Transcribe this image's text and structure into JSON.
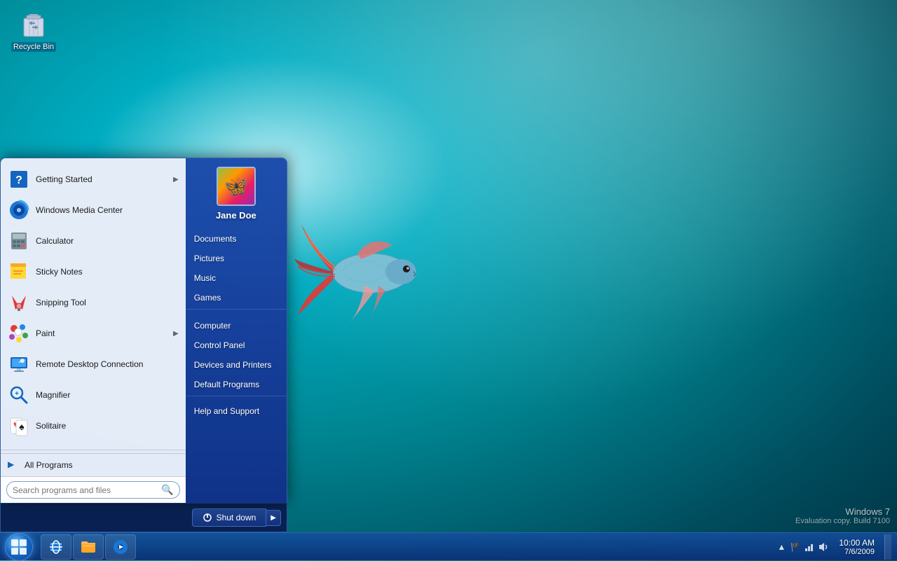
{
  "desktop": {
    "background": "underwater teal",
    "icons": [
      {
        "id": "recycle-bin",
        "label": "Recycle Bin"
      }
    ]
  },
  "taskbar": {
    "apps": [
      {
        "id": "start",
        "label": "Start"
      },
      {
        "id": "ie",
        "label": "Internet Explorer"
      },
      {
        "id": "explorer",
        "label": "Windows Explorer"
      },
      {
        "id": "media-player",
        "label": "Windows Media Player"
      }
    ],
    "clock": {
      "time": "10:00 AM",
      "date": "7/6/2009"
    },
    "watermark_line1": "Windows 7",
    "watermark_line2": "Evaluation copy. Build 7100"
  },
  "start_menu": {
    "user": {
      "name": "Jane Doe"
    },
    "left_programs": [
      {
        "id": "getting-started",
        "label": "Getting Started",
        "has_arrow": true
      },
      {
        "id": "windows-media-center",
        "label": "Windows Media Center",
        "has_arrow": false
      },
      {
        "id": "calculator",
        "label": "Calculator",
        "has_arrow": false
      },
      {
        "id": "sticky-notes",
        "label": "Sticky Notes",
        "has_arrow": false
      },
      {
        "id": "snipping-tool",
        "label": "Snipping Tool",
        "has_arrow": false
      },
      {
        "id": "paint",
        "label": "Paint",
        "has_arrow": true
      },
      {
        "id": "remote-desktop",
        "label": "Remote Desktop Connection",
        "has_arrow": false
      },
      {
        "id": "magnifier",
        "label": "Magnifier",
        "has_arrow": false
      },
      {
        "id": "solitaire",
        "label": "Solitaire",
        "has_arrow": false
      }
    ],
    "all_programs_label": "All Programs",
    "search_placeholder": "Search programs and files",
    "right_items": [
      {
        "id": "documents",
        "label": "Documents"
      },
      {
        "id": "pictures",
        "label": "Pictures"
      },
      {
        "id": "music",
        "label": "Music"
      },
      {
        "id": "games",
        "label": "Games"
      },
      {
        "id": "computer",
        "label": "Computer"
      },
      {
        "id": "control-panel",
        "label": "Control Panel"
      },
      {
        "id": "devices-printers",
        "label": "Devices and Printers"
      },
      {
        "id": "default-programs",
        "label": "Default Programs"
      },
      {
        "id": "help-support",
        "label": "Help and Support"
      }
    ],
    "shutdown_label": "Shut down"
  }
}
